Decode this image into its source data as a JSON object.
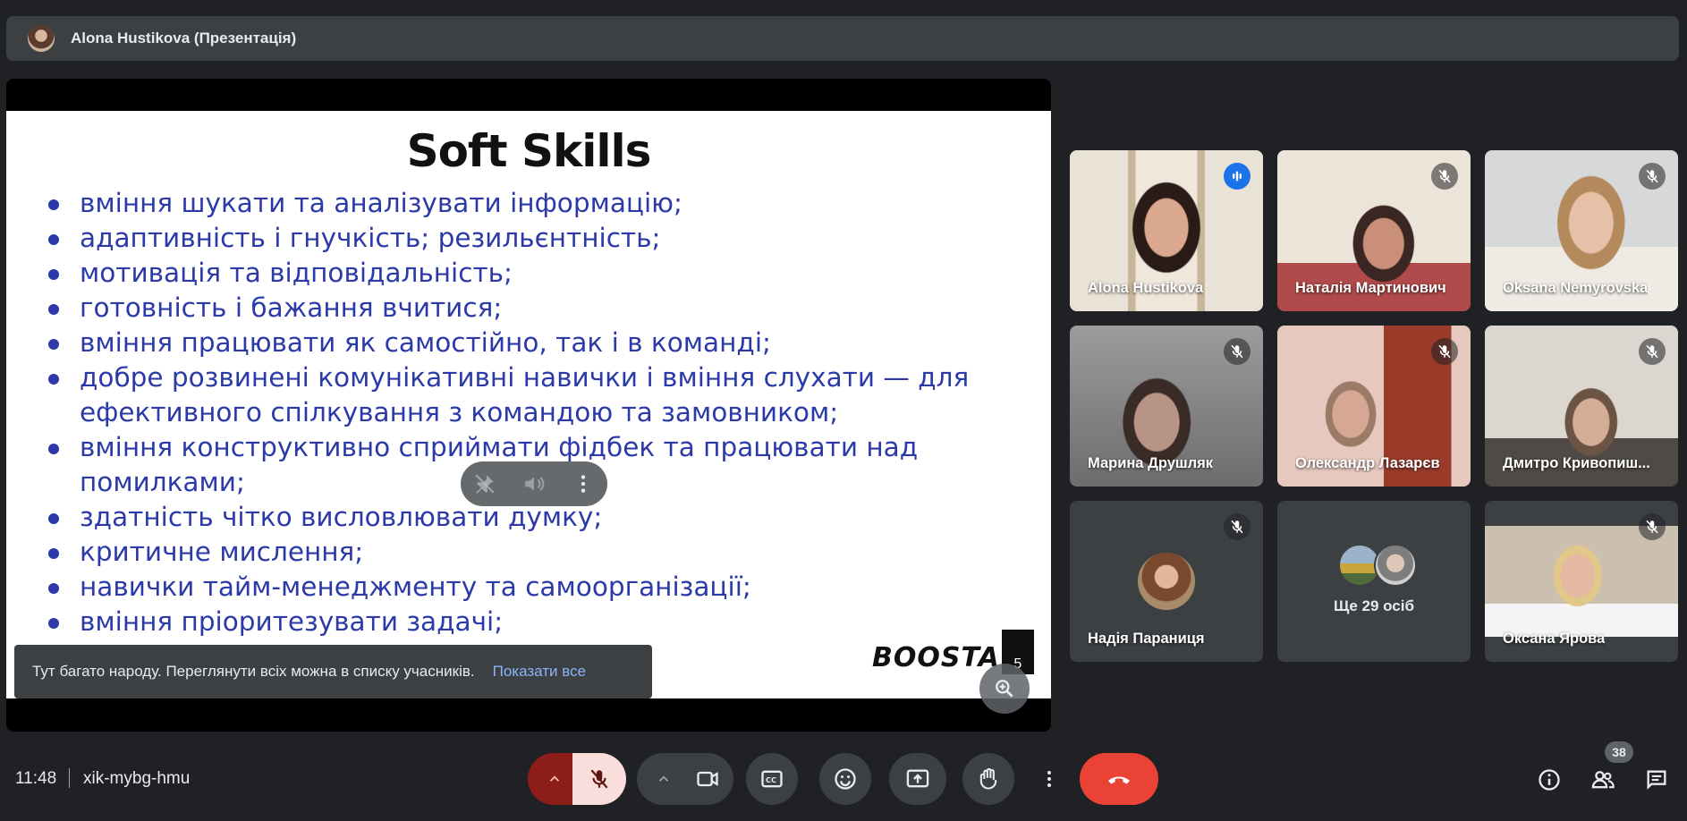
{
  "header": {
    "presenter_title": "Alona Hustikova (Презентація)"
  },
  "slide": {
    "title": "Soft Skills",
    "bullets": [
      "вміння шукати та аналізувати інформацію;",
      "адаптивність і гнучкість; резильєнтність;",
      "мотивація та відповідальність;",
      "готовність і бажання вчитися;",
      "вміння працювати як самостійно, так і в команді;",
      "добре розвинені комунікативні навички і вміння слухати — для ефективного спілкування з командою та замовником;",
      "вміння конструктивно сприймати фідбек та працювати над помилками;",
      "здатність чітко висловлювати думку;",
      "критичне мислення;",
      "навички тайм-менеджменту та самоорганізації;",
      "вміння пріоритезувати задачі;"
    ],
    "brand": "BOOSTA",
    "page_number": "5"
  },
  "toast": {
    "message": "Тут багато народу. Переглянути всіх можна в списку учасників.",
    "action": "Показати все"
  },
  "participants": [
    {
      "name": "Alona Hustikova",
      "state": "speaking"
    },
    {
      "name": "Наталія Мартинович",
      "state": "muted"
    },
    {
      "name": "Oksana Nemyrovska",
      "state": "muted"
    },
    {
      "name": "Марина Друшляк",
      "state": "muted"
    },
    {
      "name": "Олександр Лазарєв",
      "state": "muted"
    },
    {
      "name": "Дмитро Кривопиш...",
      "state": "muted"
    },
    {
      "name": "Надія Параниця",
      "state": "muted"
    },
    {
      "name": "Оксана Ярова",
      "state": "muted"
    }
  ],
  "more_participants": {
    "label": "Ще 29 осіб"
  },
  "footer": {
    "time": "11:48",
    "meeting_code": "xik-mybg-hmu",
    "people_count": "38"
  },
  "colors": {
    "background": "#202124",
    "surface": "#3c4043",
    "accent_blue": "#8ab4f8",
    "slide_text": "#2b3aa8",
    "end_call": "#ea4335",
    "mic_off_bg": "#f9dedc"
  },
  "icons": {
    "mic": "mic-off-icon",
    "camera": "videocam-icon",
    "captions": "closed-captions-icon",
    "emoji": "emoji-icon",
    "present": "present-screen-icon",
    "hand": "raise-hand-icon",
    "more": "more-vert-icon",
    "end": "call-end-icon",
    "info": "info-icon",
    "people": "people-icon",
    "chat": "chat-icon"
  }
}
